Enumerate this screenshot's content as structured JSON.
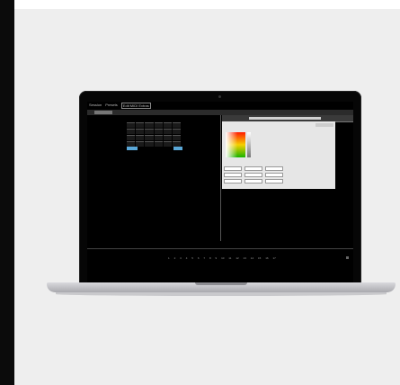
{
  "menubar": {
    "items": [
      {
        "label": "Session"
      },
      {
        "label": "Presets"
      },
      {
        "label": "Edit  MIDI  Extras",
        "boxed": true
      }
    ]
  },
  "left_panel": {
    "ruler_ticks": [
      "1",
      "2",
      "3",
      "4",
      "5",
      "6",
      "7",
      "8",
      "9",
      "10",
      "11",
      "12",
      "13",
      "14",
      "15",
      "16",
      "17"
    ]
  },
  "colors": {
    "accent": "#5aa8d8",
    "screen": "#000000",
    "dialog_bg": "#e6e6e6"
  }
}
